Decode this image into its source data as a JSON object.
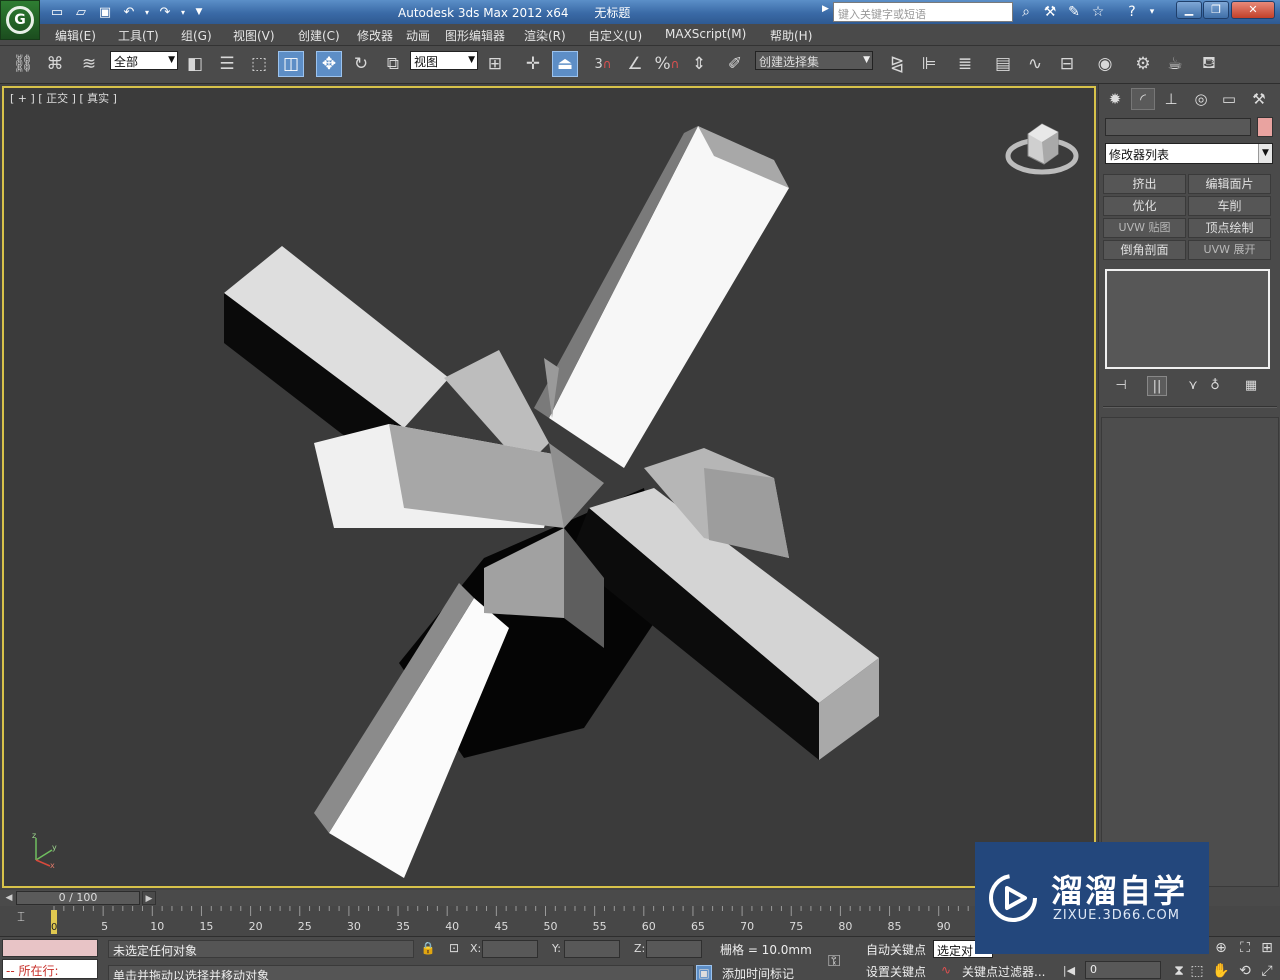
{
  "window": {
    "app_title": "Autodesk 3ds Max  2012 x64",
    "doc_title": "无标题",
    "search_placeholder": "键入关键字或短语"
  },
  "menu": [
    "编辑(E)",
    "工具(T)",
    "组(G)",
    "视图(V)",
    "创建(C)",
    "修改器",
    "动画",
    "图形编辑器",
    "渲染(R)",
    "自定义(U)",
    "MAXScript(M)",
    "帮助(H)"
  ],
  "toolbar": {
    "selection_filter": "全部",
    "ref_coord": "视图",
    "named_selection": "创建选择集",
    "snap_label": "3",
    "percent_label": "%"
  },
  "viewport": {
    "label": "[ + ] [ 正交 ] [ 真实 ]"
  },
  "command_panel": {
    "modifier_list": "修改器列表",
    "buttons": [
      "挤出",
      "编辑面片",
      "优化",
      "车削",
      "UVW 贴图",
      "顶点绘制",
      "倒角剖面",
      "UVW 展开"
    ],
    "object_color": "#e9a3a0"
  },
  "timeline": {
    "frame_display": "0 / 100",
    "ticks": [
      "0",
      "5",
      "10",
      "15",
      "20",
      "25",
      "30",
      "35",
      "40",
      "45",
      "50",
      "55",
      "60",
      "65",
      "70",
      "75",
      "80",
      "85",
      "90"
    ]
  },
  "status": {
    "listener_text": "-- 所在行:",
    "prompt_top": "未选定任何对象",
    "prompt_bottom": "单击并拖动以选择并移动对象",
    "x_label": "X:",
    "y_label": "Y:",
    "z_label": "Z:",
    "grid": "栅格 = 10.0mm",
    "add_time_tag": "添加时间标记",
    "auto_key": "自动关键点",
    "set_key": "设置关键点",
    "selected_dd": "选定对",
    "key_filters": "关键点过滤器...",
    "current_frame": "0"
  },
  "watermark": {
    "title": "溜溜自学",
    "url": "ZIXUE.3D66.COM"
  }
}
